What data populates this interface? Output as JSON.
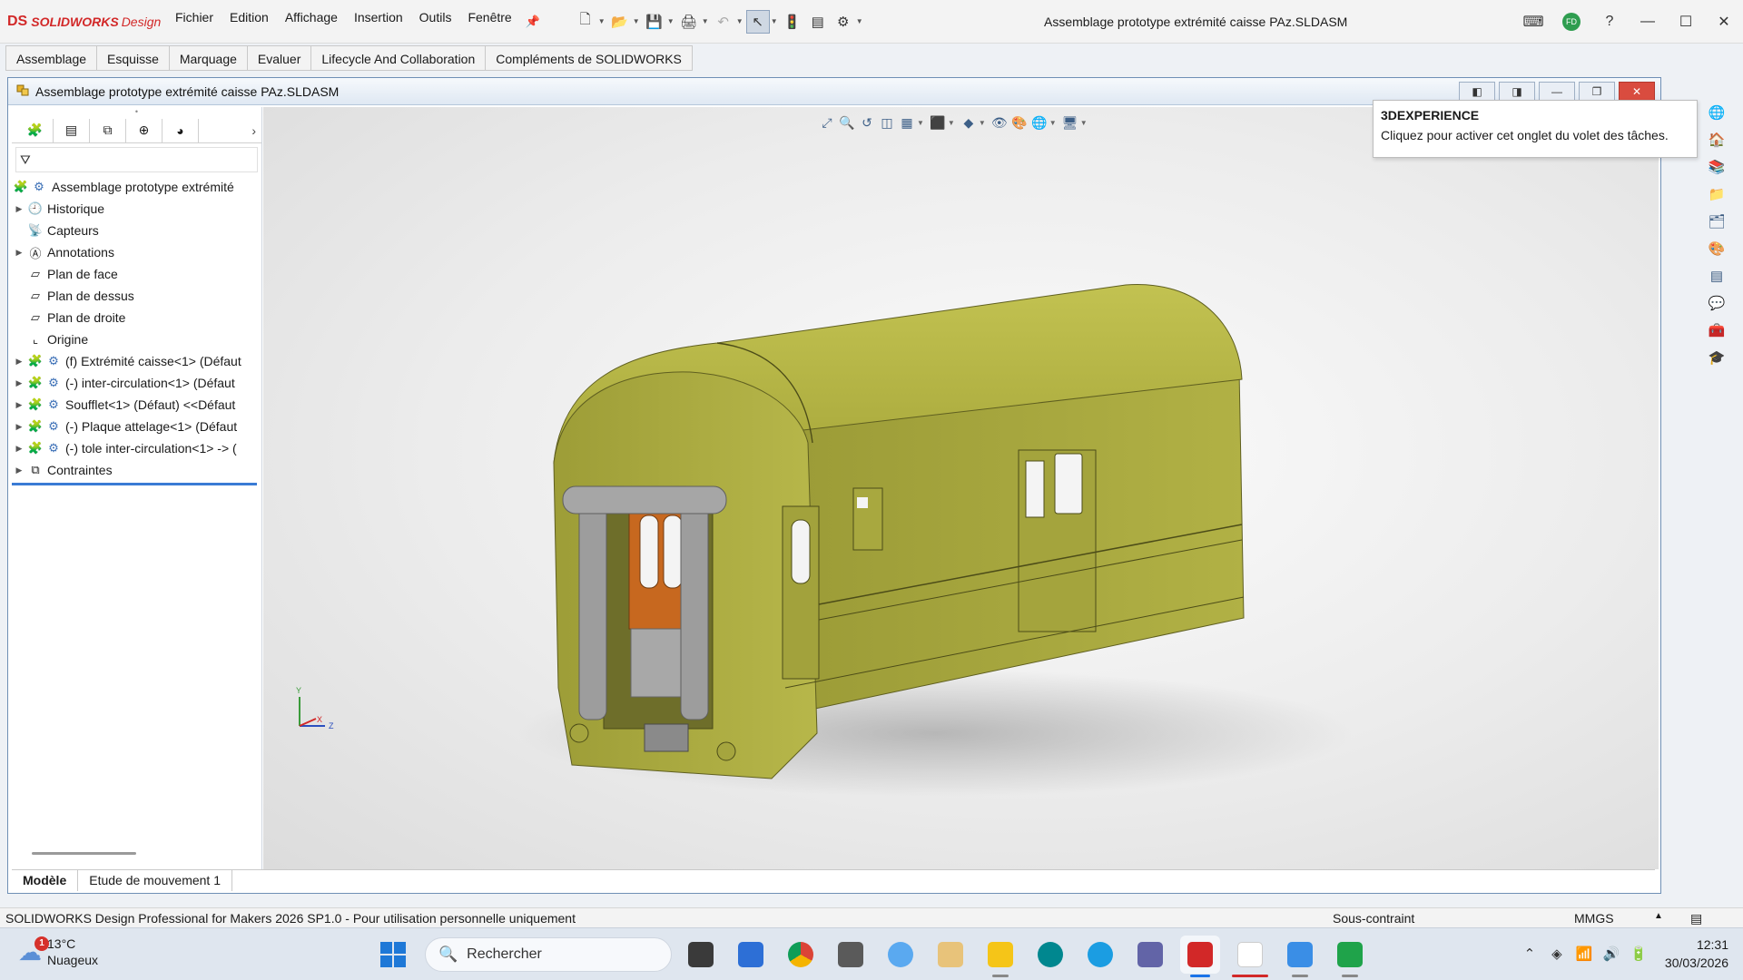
{
  "app": {
    "brand_ds": "DS",
    "brand_name": "SOLIDWORKS",
    "brand_suffix": "Design",
    "window_title": "Assemblage prototype extrémité caisse PAz.SLDASM"
  },
  "menu": [
    "Fichier",
    "Edition",
    "Affichage",
    "Insertion",
    "Outils",
    "Fenêtre"
  ],
  "user_initials": "FD",
  "command_tabs": [
    "Assemblage",
    "Esquisse",
    "Marquage",
    "Evaluer",
    "Lifecycle And Collaboration",
    "Compléments de SOLIDWORKS"
  ],
  "document": {
    "title": "Assemblage prototype extrémité caisse PAz.SLDASM"
  },
  "feature_tree": {
    "root": "Assemblage prototype extrémité",
    "items": [
      {
        "label": "Historique",
        "expandable": true,
        "icon": "history-icon"
      },
      {
        "label": "Capteurs",
        "expandable": false,
        "icon": "sensor-icon"
      },
      {
        "label": "Annotations",
        "expandable": true,
        "icon": "annotation-icon"
      },
      {
        "label": "Plan de face",
        "expandable": false,
        "icon": "plane-icon"
      },
      {
        "label": "Plan de dessus",
        "expandable": false,
        "icon": "plane-icon"
      },
      {
        "label": "Plan de droite",
        "expandable": false,
        "icon": "plane-icon"
      },
      {
        "label": "Origine",
        "expandable": false,
        "icon": "origin-icon"
      },
      {
        "label": "(f) Extrémité caisse<1> (Défaut",
        "expandable": true,
        "icon": "part-icon"
      },
      {
        "label": "(-) inter-circulation<1> (Défaut",
        "expandable": true,
        "icon": "part-icon"
      },
      {
        "label": "Soufflet<1> (Défaut) <<Défaut",
        "expandable": true,
        "icon": "part-icon"
      },
      {
        "label": "(-) Plaque attelage<1> (Défaut",
        "expandable": true,
        "icon": "part-icon"
      },
      {
        "label": "(-) tole inter-circulation<1> -> (",
        "expandable": true,
        "icon": "part-icon"
      },
      {
        "label": "Contraintes",
        "expandable": true,
        "icon": "mates-icon"
      }
    ]
  },
  "bottom_tabs": [
    "Modèle",
    "Etude de mouvement 1"
  ],
  "tooltip": {
    "title": "3DEXPERIENCE",
    "body": "Cliquez pour activer cet onglet du volet des tâches."
  },
  "triad": {
    "x": "X",
    "y": "Y",
    "z": "Z"
  },
  "status": {
    "left": "SOLIDWORKS Design Professional for Makers 2026 SP1.0 - Pour utilisation personnelle uniquement",
    "center": "Sous-contraint",
    "units": "MMGS"
  },
  "taskbar": {
    "weather_temp": "13°C",
    "weather_desc": "Nuageux",
    "weather_badge": "1",
    "search_placeholder": "Rechercher",
    "time": "12:31",
    "date": "30/03/2026"
  },
  "colors": {
    "model_body": "#a3a33a",
    "model_roof": "#b7b74a",
    "door_wood": "#c7681f",
    "accent_red": "#d22828"
  }
}
